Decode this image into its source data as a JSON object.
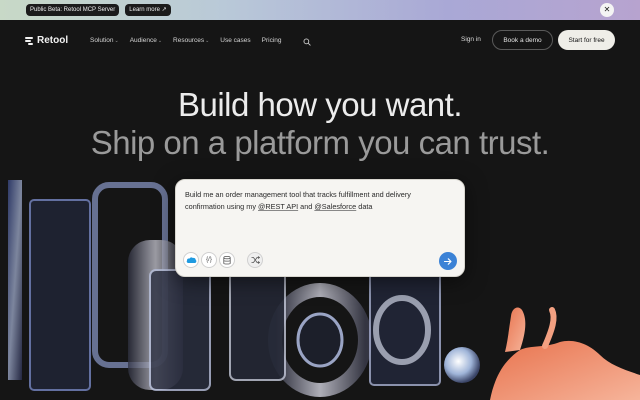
{
  "banner": {
    "badge_label": "Public Beta: Retool MCP Server",
    "learn_more_label": "Learn more ↗",
    "close_icon": "close-icon"
  },
  "nav": {
    "brand": "Retool",
    "items": [
      {
        "label": "Solution",
        "has_dropdown": true
      },
      {
        "label": "Audience",
        "has_dropdown": true
      },
      {
        "label": "Resources",
        "has_dropdown": true
      },
      {
        "label": "Use cases",
        "has_dropdown": false
      },
      {
        "label": "Pricing",
        "has_dropdown": false
      }
    ],
    "search_icon": "search-icon",
    "signin_label": "Sign in",
    "demo_label": "Book a demo",
    "start_label": "Start for free"
  },
  "hero": {
    "headline": "Build how you want.",
    "subheadline": "Ship on a platform you can trust."
  },
  "prompt": {
    "text_before": "Build me an order management tool that tracks fulfillment and delivery confirmation using my ",
    "mention_1": "@REST API",
    "text_middle": " and ",
    "mention_2": "@Salesforce",
    "text_after": " data",
    "chips": [
      {
        "icon": "salesforce-icon"
      },
      {
        "icon": "rest-api-icon",
        "glyph": "{/}"
      },
      {
        "icon": "database-icon"
      },
      {
        "icon": "shuffle-icon"
      }
    ],
    "send_icon": "arrow-right-icon"
  },
  "colors": {
    "background": "#151515",
    "send_button": "#3b82d6",
    "start_button_bg": "#efeee8",
    "banner_gradient_start": "#c8d9c7",
    "banner_gradient_end": "#b7a3cf"
  }
}
